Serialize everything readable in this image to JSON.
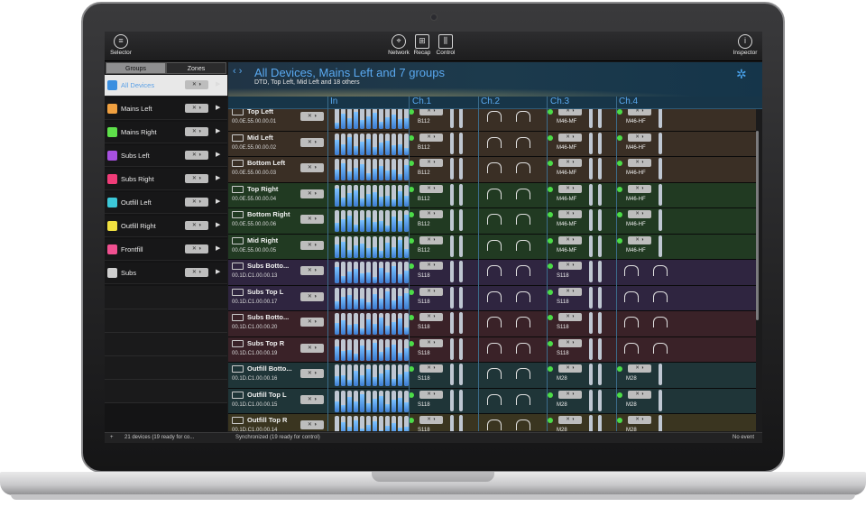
{
  "topbar": {
    "selector": "Selector",
    "network": "Network",
    "recap": "Recap",
    "control": "Control",
    "inspector": "Inspector"
  },
  "tabs": {
    "groups": "Groups",
    "zones": "Zones"
  },
  "groups": [
    {
      "label": "All Devices",
      "color": "#3b8fe0"
    },
    {
      "label": "Mains Left",
      "color": "#f0a040"
    },
    {
      "label": "Mains Right",
      "color": "#5ee04a"
    },
    {
      "label": "Subs Left",
      "color": "#a750e0"
    },
    {
      "label": "Subs Right",
      "color": "#f03c78"
    },
    {
      "label": "Outfill Left",
      "color": "#3cc8d8"
    },
    {
      "label": "Outfill Right",
      "color": "#f0e040"
    },
    {
      "label": "Frontfill",
      "color": "#f05090"
    },
    {
      "label": "Subs",
      "color": "#cfcfcf"
    }
  ],
  "header": {
    "title": "All Devices, Mains Left and 7 groups",
    "subtitle": "DTD, Top Left, Mid Left and 18 others"
  },
  "columns": {
    "in": "In",
    "ch1": "Ch.1",
    "ch2": "Ch.2",
    "ch3": "Ch.3",
    "ch4": "Ch.4"
  },
  "devices": [
    {
      "name": "Top Left",
      "addr": "00.0E.55.00.00.01",
      "ch1": "B112",
      "ch3": "M46-MF",
      "ch4": "M46-HF",
      "tint": "#3a2f25"
    },
    {
      "name": "Mid Left",
      "addr": "00.0E.55.00.00.02",
      "ch1": "B112",
      "ch3": "M46-MF",
      "ch4": "M46-HF",
      "tint": "#3a2f25"
    },
    {
      "name": "Bottom Left",
      "addr": "00.0E.55.00.00.03",
      "ch1": "B112",
      "ch3": "M46-MF",
      "ch4": "M46-HF",
      "tint": "#3a2f25"
    },
    {
      "name": "Top Right",
      "addr": "00.0E.55.00.00.04",
      "ch1": "B112",
      "ch3": "M46-MF",
      "ch4": "M46-HF",
      "tint": "#213a22"
    },
    {
      "name": "Bottom Right",
      "addr": "00.0E.55.00.00.06",
      "ch1": "B112",
      "ch3": "M46-MF",
      "ch4": "M46-HF",
      "tint": "#213a22"
    },
    {
      "name": "Mid Right",
      "addr": "00.0E.55.00.00.05",
      "ch1": "B112",
      "ch3": "M46-MF",
      "ch4": "M46-HF",
      "tint": "#213a22"
    },
    {
      "name": "Subs Botto...",
      "addr": "00.1D.C1.00.00.13",
      "ch1": "S118",
      "ch3": "S118",
      "ch4": "",
      "tint": "#2f2540"
    },
    {
      "name": "Subs Top L",
      "addr": "00.1D.C1.00.00.17",
      "ch1": "S118",
      "ch3": "S118",
      "ch4": "",
      "tint": "#2f2540"
    },
    {
      "name": "Subs Botto...",
      "addr": "00.1D.C1.00.00.20",
      "ch1": "S118",
      "ch3": "S118",
      "ch4": "",
      "tint": "#3a2228"
    },
    {
      "name": "Subs Top R",
      "addr": "00.1D.C1.00.00.19",
      "ch1": "S118",
      "ch3": "S118",
      "ch4": "",
      "tint": "#3a2228"
    },
    {
      "name": "Outfill Botto...",
      "addr": "00.1D.C1.00.00.16",
      "ch1": "S118",
      "ch3": "M28",
      "ch4": "M28",
      "tint": "#1f3538"
    },
    {
      "name": "Outfill Top L",
      "addr": "00.1D.C1.00.00.15",
      "ch1": "S118",
      "ch3": "M28",
      "ch4": "M28",
      "tint": "#1f3538"
    },
    {
      "name": "Outfill Top R",
      "addr": "00.1D.C1.00.00.14",
      "ch1": "S118",
      "ch3": "M28",
      "ch4": "M28",
      "tint": "#3a3520"
    }
  ],
  "status": {
    "left": "21 devices (19 ready for co...",
    "center": "Synchronized (19 ready for control)",
    "right": "No event"
  }
}
